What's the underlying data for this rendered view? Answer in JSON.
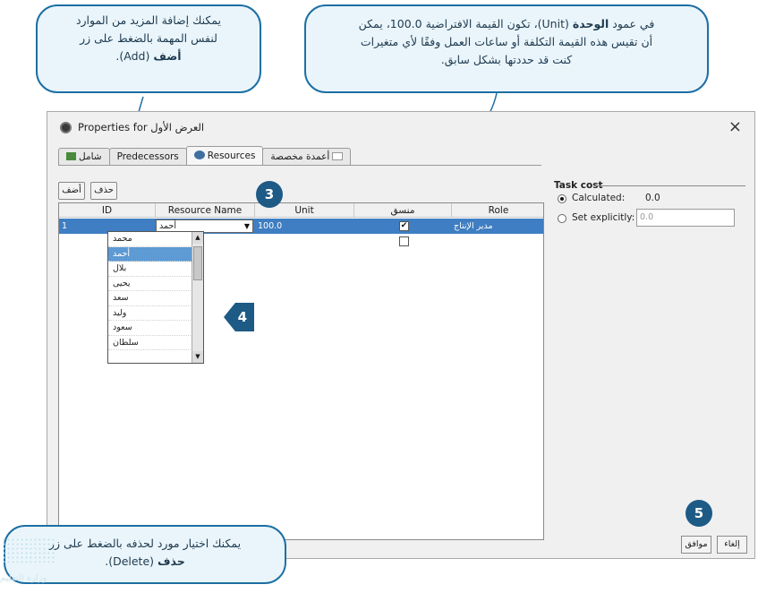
{
  "callouts": {
    "add": {
      "text1": "يمكنك إضافة المزيد من الموارد",
      "text2": "لنفس المهمة بالضغط على زر",
      "bold": "أضف",
      "rest": " (Add)."
    },
    "unit": {
      "pre": "في عمود ",
      "bold": "الوحدة",
      "post": " (Unit)، تكون القيمة الافتراضية 100.0، يمكن",
      "line2": "أن تقيس هذه القيمة التكلفة أو ساعات العمل وفقًا لأي متغيرات",
      "line3": "كنت قد حددتها بشكل سابق."
    },
    "delete": {
      "line1": "يمكنك اختيار مورد لحذفه بالضغط على زر",
      "bold": "حذف",
      "rest": " (Delete)."
    }
  },
  "badges": {
    "b3": "3",
    "b4": "4",
    "b5": "5"
  },
  "dialog": {
    "title_en": "Properties for",
    "title_ar": "العرض الأول",
    "close": "×",
    "tabs": [
      {
        "label": "شامل"
      },
      {
        "label": "Predecessors"
      },
      {
        "label": "Resources"
      },
      {
        "label": "أعمدة مخصصة"
      }
    ],
    "buttons": {
      "add": "أضف",
      "delete": "حذف"
    },
    "columns": [
      "ID",
      "Resource Name",
      "Unit",
      "منسق",
      "Role"
    ],
    "row": {
      "id": "1",
      "resource": "أحمد",
      "unit": "100.0",
      "role": "مدير الإنتاج"
    },
    "dropdown": [
      "محمد",
      "أحمد",
      "بلال",
      "يحيى",
      "سعد",
      "وليد",
      "سعود",
      "سلطان"
    ],
    "task_cost": {
      "legend": "Task cost",
      "calculated_label": "Calculated:",
      "calculated_value": "0.0",
      "explicit_label": "Set explicitly:",
      "explicit_value": "0.0"
    },
    "footer": {
      "ok": "موافق",
      "cancel": "إلغاء"
    }
  },
  "watermark": "وزارة التعليم",
  "colors": {
    "accent": "#1d6fa3",
    "badge": "#1d5a86",
    "selection": "#3f7ec2"
  }
}
